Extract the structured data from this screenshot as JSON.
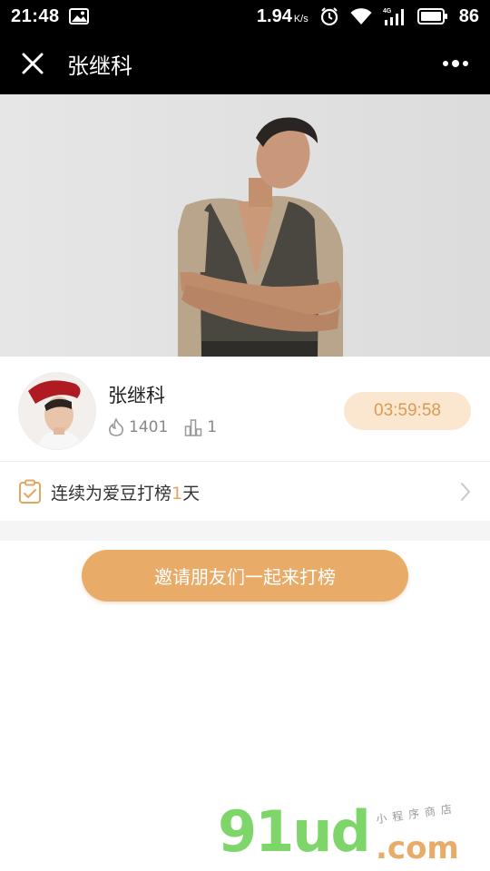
{
  "status_bar": {
    "time": "21:48",
    "network_speed": "1.94",
    "speed_unit": "K/s",
    "battery": "86",
    "icons": [
      "image-icon",
      "alarm-icon",
      "wifi-icon",
      "4g-signal-icon",
      "battery-icon"
    ]
  },
  "title_bar": {
    "title": "张继科",
    "close_icon": "close-icon",
    "more_icon": "more-dots-icon"
  },
  "idol": {
    "name": "张继科",
    "heat": "1401",
    "rank": "1",
    "heat_icon": "flame-icon",
    "rank_icon": "bar-chart-icon",
    "countdown": "03:59:58"
  },
  "streak": {
    "prefix": "连续为爱豆打榜",
    "days": "1",
    "suffix": "天",
    "icon": "clipboard-check-icon"
  },
  "invite_button": {
    "label": "邀请朋友们一起来打榜"
  },
  "watermark": {
    "brand": "91ud",
    "domain": ".com",
    "slogan": "小程序商店"
  },
  "colors": {
    "accent": "#e8ac68",
    "timer_bg": "#fbe7d0",
    "timer_text": "#d99a55",
    "brand_green": "#7ed66a"
  }
}
